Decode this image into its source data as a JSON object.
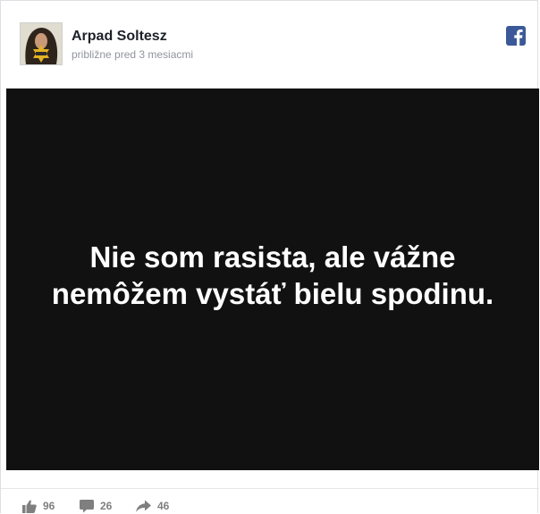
{
  "post": {
    "author_name": "Arpad Soltesz",
    "timestamp": "približne pred 3 mesiacmi",
    "image_text": "Nie som rasista, ale vážne nemôžem vystáť bielu spodinu.",
    "image_background": "#111111"
  },
  "footer": {
    "likes": "96",
    "comments": "26",
    "shares": "46"
  },
  "icons": {
    "platform": "facebook-icon",
    "like": "thumbs-up-icon",
    "comment": "comment-bubble-icon",
    "share": "share-arrow-icon"
  },
  "colors": {
    "facebook_blue": "#3b5998",
    "author_text": "#1d2129",
    "meta_text": "#90949c",
    "counter_text": "#7f7f7f"
  }
}
